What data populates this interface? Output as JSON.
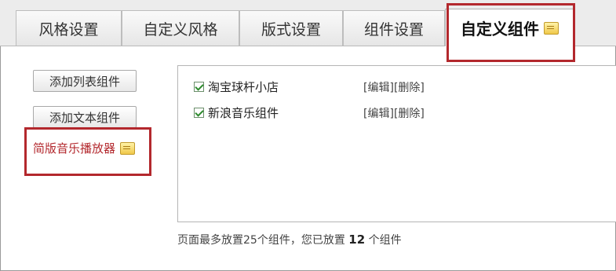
{
  "tabs": [
    {
      "label": "风格设置"
    },
    {
      "label": "自定义风格"
    },
    {
      "label": "版式设置"
    },
    {
      "label": "组件设置"
    },
    {
      "label": "自定义组件",
      "active": true
    }
  ],
  "sidebar": {
    "add_list_label": "添加列表组件",
    "add_text_label": "添加文本组件",
    "player_label": "简版音乐播放器"
  },
  "components": [
    {
      "name": "淘宝球杆小店",
      "checked": true,
      "edit": "[编辑]",
      "delete": "[删除]"
    },
    {
      "name": "新浪音乐组件",
      "checked": true,
      "edit": "[编辑]",
      "delete": "[删除]"
    }
  ],
  "footer": {
    "prefix": "页面最多放置25个组件，您已放置 ",
    "count": "12",
    "suffix": " 个组件"
  },
  "colors": {
    "highlight": "#b3282d",
    "checkmark": "#2e8b2e"
  },
  "icons": {
    "tab_note": "note-icon",
    "player_note": "note-icon"
  }
}
